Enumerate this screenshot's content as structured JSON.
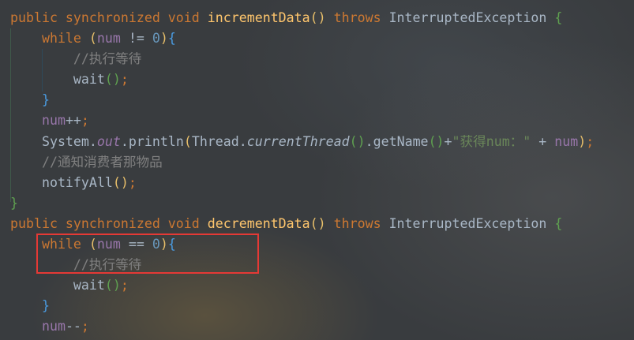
{
  "code_lines": [
    [
      [
        "public synchronized void ",
        "kw"
      ],
      [
        "incrementData",
        "fn"
      ],
      [
        "() ",
        "p1"
      ],
      [
        "throws ",
        "kw"
      ],
      [
        "InterruptedException ",
        "tx"
      ],
      [
        "{",
        "p2"
      ]
    ],
    [
      [
        "    while ",
        "kw"
      ],
      [
        "(",
        "p1"
      ],
      [
        "num",
        "fld"
      ],
      [
        " != ",
        "tx"
      ],
      [
        "0",
        "num"
      ],
      [
        ")",
        "p1"
      ],
      [
        "{",
        "p3"
      ]
    ],
    [
      [
        "        //执行等待",
        "cm"
      ]
    ],
    [
      [
        "        wait",
        "tx"
      ],
      [
        "()",
        "p2"
      ],
      [
        ";",
        "sc"
      ]
    ],
    [
      [
        "    }",
        "p3"
      ]
    ],
    [
      [
        "    num",
        "fld"
      ],
      [
        "++",
        "tx"
      ],
      [
        ";",
        "sc"
      ]
    ],
    [
      [
        "    System.",
        "tx"
      ],
      [
        "out",
        "sf"
      ],
      [
        ".println",
        "tx"
      ],
      [
        "(",
        "p1"
      ],
      [
        "Thread.",
        "tx"
      ],
      [
        "currentThread",
        "it"
      ],
      [
        "()",
        "p2"
      ],
      [
        ".getName",
        "tx"
      ],
      [
        "()",
        "p2"
      ],
      [
        "+",
        "tx"
      ],
      [
        "\"获得num：\"",
        "str"
      ],
      [
        " + ",
        "tx"
      ],
      [
        "num",
        "fld"
      ],
      [
        ")",
        "p1"
      ],
      [
        ";",
        "sc"
      ]
    ],
    [
      [
        "    //通知消费者那物品",
        "cm"
      ]
    ],
    [
      [
        "    notifyAll",
        "tx"
      ],
      [
        "()",
        "p1"
      ],
      [
        ";",
        "sc"
      ]
    ],
    [
      [
        "}",
        "p2"
      ]
    ],
    [
      [
        "public synchronized void ",
        "kw"
      ],
      [
        "decrementData",
        "fn"
      ],
      [
        "() ",
        "p1"
      ],
      [
        "throws ",
        "kw"
      ],
      [
        "InterruptedException ",
        "tx"
      ],
      [
        "{",
        "p2"
      ]
    ],
    [
      [
        "    while ",
        "kw"
      ],
      [
        "(",
        "p1"
      ],
      [
        "num",
        "fld"
      ],
      [
        " == ",
        "tx"
      ],
      [
        "0",
        "num"
      ],
      [
        ")",
        "p1"
      ],
      [
        "{",
        "p3"
      ]
    ],
    [
      [
        "        //执行等待",
        "cm"
      ]
    ],
    [
      [
        "        wait",
        "tx"
      ],
      [
        "()",
        "p2"
      ],
      [
        ";",
        "sc"
      ]
    ],
    [
      [
        "    }",
        "p3"
      ]
    ],
    [
      [
        "    num",
        "fld"
      ],
      [
        "--",
        "tx"
      ],
      [
        ";",
        "sc"
      ]
    ]
  ],
  "highlight": {
    "color": "#e53935",
    "lines": "while (num == 0){ //执行等待"
  }
}
